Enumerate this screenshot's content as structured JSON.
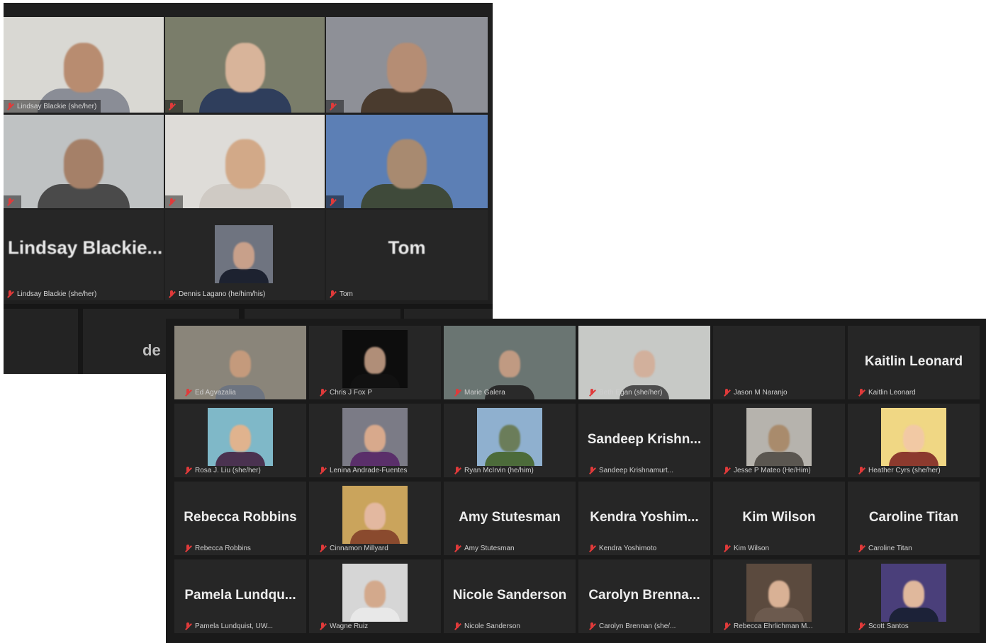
{
  "window_top": {
    "video_tiles": [
      {
        "id": "t1",
        "label": "Lindsay Blackie (she/her)",
        "active_speaker": true,
        "bg": "#d9d8d3",
        "face": "#b88c70",
        "shirt": "#8a8d96"
      },
      {
        "id": "t2",
        "label": "",
        "active_speaker": false,
        "bg": "#7a7d6a",
        "face": "#d8b49a",
        "shirt": "#2f3e5c"
      },
      {
        "id": "t3",
        "label": "",
        "active_speaker": false,
        "bg": "#8e9097",
        "face": "#b58d74",
        "shirt": "#4a3b2e"
      },
      {
        "id": "t4",
        "label": "",
        "active_speaker": false,
        "bg": "#bfc2c3",
        "face": "#a58068",
        "shirt": "#4a4a4a"
      },
      {
        "id": "t5",
        "label": "",
        "active_speaker": false,
        "bg": "#dedcd8",
        "face": "#d2a988",
        "shirt": "#cfcac4"
      },
      {
        "id": "t6",
        "label": "",
        "active_speaker": false,
        "bg": "#5c7fb5",
        "face": "#a88a70",
        "shirt": "#3f4a3a"
      }
    ],
    "name_tiles": [
      {
        "id": "n1",
        "big_name": "Lindsay Blackie...",
        "label": "Lindsay Blackie (she/her)"
      },
      {
        "id": "n2",
        "big_name": "",
        "label": "Dennis Lagano (he/him/his)",
        "has_photo": true
      },
      {
        "id": "n3",
        "big_name": "Tom",
        "label": "Tom"
      }
    ],
    "strip_text": "de"
  },
  "window_bottom": {
    "tiles": [
      {
        "big_name": "",
        "label": "Ed Agvazalia",
        "photo": {
          "bg": "#8a857a",
          "face": "#c49a7c",
          "shirt": "#6d7480"
        }
      },
      {
        "big_name": "",
        "label": "Chris J Fox P",
        "photo": {
          "bg": "#0d0d0d",
          "face": "#b08e78",
          "shirt": "#111111"
        }
      },
      {
        "big_name": "",
        "label": "Marie Galera",
        "photo": {
          "bg": "#6a7572",
          "face": "#c09a82",
          "shirt": "#2a2a2a"
        }
      },
      {
        "big_name": "",
        "label": "Beth Egan (she/her)",
        "photo": {
          "bg": "#c7c9c6",
          "face": "#d2b09c",
          "shirt": "#4d4d4d"
        }
      },
      {
        "big_name": "",
        "label": "Jason M Naranjo",
        "photo": null
      },
      {
        "big_name": "Kaitlin Leonard",
        "label": "Kaitlin Leonard",
        "photo": null
      },
      {
        "big_name": "",
        "label": "Rosa J. Liu (she/her)",
        "photo": {
          "bg": "#7fb8c8",
          "face": "#e0b38e",
          "shirt": "#4a3250"
        }
      },
      {
        "big_name": "",
        "label": "Lenina Andrade-Fuentes",
        "photo": {
          "bg": "#7b7b86",
          "face": "#d8a98c",
          "shirt": "#5a2f6a"
        }
      },
      {
        "big_name": "",
        "label": "Ryan McIrvin (he/him)",
        "photo": {
          "bg": "#8fb0cf",
          "face": "#6b7d5a",
          "shirt": "#4c6b3a"
        }
      },
      {
        "big_name": "Sandeep Krishn...",
        "label": "Sandeep Krishnamurt...",
        "photo": null
      },
      {
        "big_name": "",
        "label": "Jesse P Mateo (He/Him)",
        "photo": {
          "bg": "#b6b3ad",
          "face": "#a98b6c",
          "shirt": "#5a5650"
        }
      },
      {
        "big_name": "",
        "label": "Heather Cyrs (she/her)",
        "photo": {
          "bg": "#f0d784",
          "face": "#f2c9a4",
          "shirt": "#8c3a2e"
        }
      },
      {
        "big_name": "Rebecca Robbins",
        "label": "Rebecca Robbins",
        "photo": null
      },
      {
        "big_name": "",
        "label": "Cinnamon Millyard",
        "photo": {
          "bg": "#caa45c",
          "face": "#e3b8a0",
          "shirt": "#8a4a2e"
        }
      },
      {
        "big_name": "Amy Stutesman",
        "label": "Amy Stutesman",
        "photo": null
      },
      {
        "big_name": "Kendra Yoshim...",
        "label": "Kendra Yoshimoto",
        "photo": null
      },
      {
        "big_name": "Kim Wilson",
        "label": "Kim Wilson",
        "photo": null
      },
      {
        "big_name": "Caroline Titan",
        "label": "Caroline Titan",
        "photo": null
      },
      {
        "big_name": "Pamela Lundqu...",
        "label": "Pamela Lundquist, UW...",
        "photo": null
      },
      {
        "big_name": "",
        "label": "Wagne Ruiz",
        "photo": {
          "bg": "#d6d6d6",
          "face": "#d3a98c",
          "shirt": "#e8e8e8"
        }
      },
      {
        "big_name": "Nicole Sanderson",
        "label": "Nicole Sanderson",
        "photo": null
      },
      {
        "big_name": "Carolyn Brenna...",
        "label": "Carolyn Brennan (she/...",
        "photo": null
      },
      {
        "big_name": "",
        "label": "Rebecca Ehrlichman M...",
        "photo": {
          "bg": "#5b4a3e",
          "face": "#d9b195",
          "shirt": "#6c5a4e"
        }
      },
      {
        "big_name": "",
        "label": "Scott Santos",
        "photo": {
          "bg": "#4a3f7a",
          "face": "#e0b89c",
          "shirt": "#1c2238"
        }
      }
    ]
  },
  "colors": {
    "speaker_outline": "#9cc42f",
    "muted_mic": "#e03a3a",
    "tile_bg": "#262626"
  }
}
